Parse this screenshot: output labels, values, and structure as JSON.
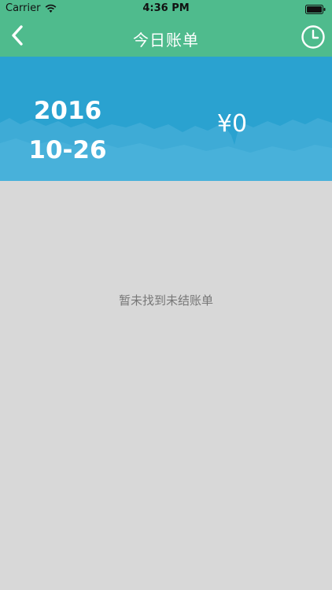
{
  "status_bar": {
    "carrier": "Carrier",
    "time": "4:36 PM"
  },
  "nav": {
    "title": "今日账单",
    "back_icon": "chevron-left-icon",
    "history_icon": "clock-icon"
  },
  "summary": {
    "year": "2016",
    "month_day": "10-26",
    "amount": "¥0"
  },
  "empty_state": {
    "message": "暂未找到未结账单"
  },
  "colors": {
    "header": "#4fbb8d",
    "banner": "#2aa2d0",
    "background": "#d8d8d8",
    "message": "#777777"
  }
}
